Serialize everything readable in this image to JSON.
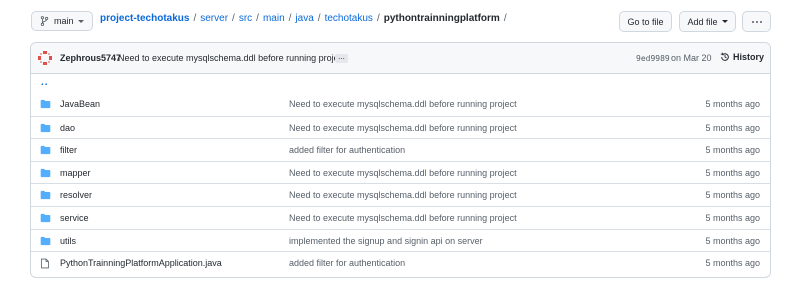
{
  "branch": {
    "name": "main"
  },
  "breadcrumb": [
    {
      "label": "project-techotakus",
      "kind": "repo"
    },
    {
      "label": "server",
      "kind": "link"
    },
    {
      "label": "src",
      "kind": "link"
    },
    {
      "label": "main",
      "kind": "link"
    },
    {
      "label": "java",
      "kind": "link"
    },
    {
      "label": "techotakus",
      "kind": "link"
    },
    {
      "label": "pythontrainningplatform",
      "kind": "current"
    }
  ],
  "separator": "/",
  "buttons": {
    "go_to_file": "Go to file",
    "add_file": "Add file"
  },
  "commit": {
    "author": "Zephrous5747",
    "message": "Need to execute mysqlschema.ddl before running project",
    "ellipsis": "...",
    "sha": "9ed9989",
    "date": "on Mar 20",
    "history_label": "History"
  },
  "parent_dir": "..",
  "files": [
    {
      "name": "JavaBean",
      "type": "folder",
      "message": "Need to execute mysqlschema.ddl before running project",
      "age": "5 months ago"
    },
    {
      "name": "dao",
      "type": "folder",
      "message": "Need to execute mysqlschema.ddl before running project",
      "age": "5 months ago"
    },
    {
      "name": "filter",
      "type": "folder",
      "message": "added filter for authentication",
      "age": "5 months ago"
    },
    {
      "name": "mapper",
      "type": "folder",
      "message": "Need to execute mysqlschema.ddl before running project",
      "age": "5 months ago"
    },
    {
      "name": "resolver",
      "type": "folder",
      "message": "Need to execute mysqlschema.ddl before running project",
      "age": "5 months ago"
    },
    {
      "name": "service",
      "type": "folder",
      "message": "Need to execute mysqlschema.ddl before running project",
      "age": "5 months ago"
    },
    {
      "name": "utils",
      "type": "folder",
      "message": "implemented the signup and signin api on server",
      "age": "5 months ago"
    },
    {
      "name": "PythonTrainningPlatformApplication.java",
      "type": "file",
      "message": "added filter for authentication",
      "age": "5 months ago"
    }
  ],
  "colors": {
    "link": "#0969da",
    "folder": "#54aeff",
    "muted": "#57606a",
    "border": "#d0d7de"
  }
}
